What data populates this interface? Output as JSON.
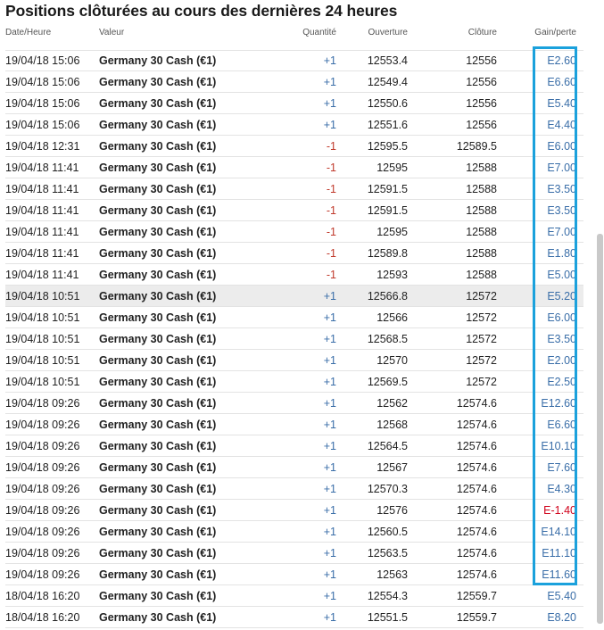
{
  "title": "Positions clôturées au cours des dernières 24 heures",
  "columns": {
    "date": "Date/Heure",
    "valeur": "Valeur",
    "quantite": "Quantité",
    "ouverture": "Ouverture",
    "cloture": "Clôture",
    "gain": "Gain/perte"
  },
  "rows": [
    {
      "date": "19/04/18 15:06",
      "valeur": "Germany 30 Cash (€1)",
      "quantite": "+1",
      "ouverture": "12553.4",
      "cloture": "12556",
      "gain": "E2.60",
      "neg": false
    },
    {
      "date": "19/04/18 15:06",
      "valeur": "Germany 30 Cash (€1)",
      "quantite": "+1",
      "ouverture": "12549.4",
      "cloture": "12556",
      "gain": "E6.60",
      "neg": false
    },
    {
      "date": "19/04/18 15:06",
      "valeur": "Germany 30 Cash (€1)",
      "quantite": "+1",
      "ouverture": "12550.6",
      "cloture": "12556",
      "gain": "E5.40",
      "neg": false
    },
    {
      "date": "19/04/18 15:06",
      "valeur": "Germany 30 Cash (€1)",
      "quantite": "+1",
      "ouverture": "12551.6",
      "cloture": "12556",
      "gain": "E4.40",
      "neg": false
    },
    {
      "date": "19/04/18 12:31",
      "valeur": "Germany 30 Cash (€1)",
      "quantite": "-1",
      "ouverture": "12595.5",
      "cloture": "12589.5",
      "gain": "E6.00",
      "neg": false
    },
    {
      "date": "19/04/18 11:41",
      "valeur": "Germany 30 Cash (€1)",
      "quantite": "-1",
      "ouverture": "12595",
      "cloture": "12588",
      "gain": "E7.00",
      "neg": false
    },
    {
      "date": "19/04/18 11:41",
      "valeur": "Germany 30 Cash (€1)",
      "quantite": "-1",
      "ouverture": "12591.5",
      "cloture": "12588",
      "gain": "E3.50",
      "neg": false
    },
    {
      "date": "19/04/18 11:41",
      "valeur": "Germany 30 Cash (€1)",
      "quantite": "-1",
      "ouverture": "12591.5",
      "cloture": "12588",
      "gain": "E3.50",
      "neg": false
    },
    {
      "date": "19/04/18 11:41",
      "valeur": "Germany 30 Cash (€1)",
      "quantite": "-1",
      "ouverture": "12595",
      "cloture": "12588",
      "gain": "E7.00",
      "neg": false
    },
    {
      "date": "19/04/18 11:41",
      "valeur": "Germany 30 Cash (€1)",
      "quantite": "-1",
      "ouverture": "12589.8",
      "cloture": "12588",
      "gain": "E1.80",
      "neg": false
    },
    {
      "date": "19/04/18 11:41",
      "valeur": "Germany 30 Cash (€1)",
      "quantite": "-1",
      "ouverture": "12593",
      "cloture": "12588",
      "gain": "E5.00",
      "neg": false
    },
    {
      "date": "19/04/18 10:51",
      "valeur": "Germany 30 Cash (€1)",
      "quantite": "+1",
      "ouverture": "12566.8",
      "cloture": "12572",
      "gain": "E5.20",
      "neg": false,
      "highlight": true
    },
    {
      "date": "19/04/18 10:51",
      "valeur": "Germany 30 Cash (€1)",
      "quantite": "+1",
      "ouverture": "12566",
      "cloture": "12572",
      "gain": "E6.00",
      "neg": false
    },
    {
      "date": "19/04/18 10:51",
      "valeur": "Germany 30 Cash (€1)",
      "quantite": "+1",
      "ouverture": "12568.5",
      "cloture": "12572",
      "gain": "E3.50",
      "neg": false
    },
    {
      "date": "19/04/18 10:51",
      "valeur": "Germany 30 Cash (€1)",
      "quantite": "+1",
      "ouverture": "12570",
      "cloture": "12572",
      "gain": "E2.00",
      "neg": false
    },
    {
      "date": "19/04/18 10:51",
      "valeur": "Germany 30 Cash (€1)",
      "quantite": "+1",
      "ouverture": "12569.5",
      "cloture": "12572",
      "gain": "E2.50",
      "neg": false
    },
    {
      "date": "19/04/18 09:26",
      "valeur": "Germany 30 Cash (€1)",
      "quantite": "+1",
      "ouverture": "12562",
      "cloture": "12574.6",
      "gain": "E12.60",
      "neg": false
    },
    {
      "date": "19/04/18 09:26",
      "valeur": "Germany 30 Cash (€1)",
      "quantite": "+1",
      "ouverture": "12568",
      "cloture": "12574.6",
      "gain": "E6.60",
      "neg": false
    },
    {
      "date": "19/04/18 09:26",
      "valeur": "Germany 30 Cash (€1)",
      "quantite": "+1",
      "ouverture": "12564.5",
      "cloture": "12574.6",
      "gain": "E10.10",
      "neg": false
    },
    {
      "date": "19/04/18 09:26",
      "valeur": "Germany 30 Cash (€1)",
      "quantite": "+1",
      "ouverture": "12567",
      "cloture": "12574.6",
      "gain": "E7.60",
      "neg": false
    },
    {
      "date": "19/04/18 09:26",
      "valeur": "Germany 30 Cash (€1)",
      "quantite": "+1",
      "ouverture": "12570.3",
      "cloture": "12574.6",
      "gain": "E4.30",
      "neg": false
    },
    {
      "date": "19/04/18 09:26",
      "valeur": "Germany 30 Cash (€1)",
      "quantite": "+1",
      "ouverture": "12576",
      "cloture": "12574.6",
      "gain": "E-1.40",
      "neg": true
    },
    {
      "date": "19/04/18 09:26",
      "valeur": "Germany 30 Cash (€1)",
      "quantite": "+1",
      "ouverture": "12560.5",
      "cloture": "12574.6",
      "gain": "E14.10",
      "neg": false
    },
    {
      "date": "19/04/18 09:26",
      "valeur": "Germany 30 Cash (€1)",
      "quantite": "+1",
      "ouverture": "12563.5",
      "cloture": "12574.6",
      "gain": "E11.10",
      "neg": false
    },
    {
      "date": "19/04/18 09:26",
      "valeur": "Germany 30 Cash (€1)",
      "quantite": "+1",
      "ouverture": "12563",
      "cloture": "12574.6",
      "gain": "E11.60",
      "neg": false
    },
    {
      "date": "18/04/18 16:20",
      "valeur": "Germany 30 Cash (€1)",
      "quantite": "+1",
      "ouverture": "12554.3",
      "cloture": "12559.7",
      "gain": "E5.40",
      "neg": false
    },
    {
      "date": "18/04/18 16:20",
      "valeur": "Germany 30 Cash (€1)",
      "quantite": "+1",
      "ouverture": "12551.5",
      "cloture": "12559.7",
      "gain": "E8.20",
      "neg": false
    }
  ],
  "colors": {
    "positive": "#3a6ea8",
    "negative": "#d0021b",
    "highlight_box": "#1ba1dc",
    "row_highlight": "#ececec"
  }
}
